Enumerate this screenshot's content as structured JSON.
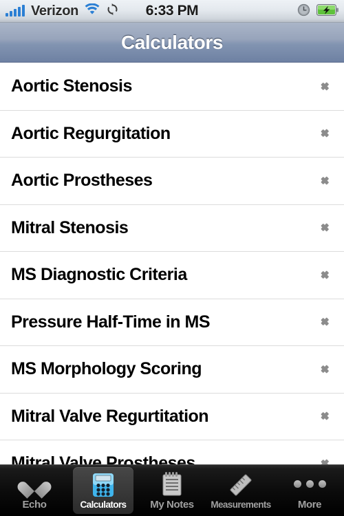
{
  "status_bar": {
    "signal_icon": "signal-bars-icon",
    "signal_bars": 5,
    "carrier": "Verizon",
    "wifi_icon": "wifi-icon",
    "sync_icon": "sync-rotate-icon",
    "time": "6:33 PM",
    "alarm_icon": "alarm-clock-icon",
    "battery_icon": "battery-charging-icon",
    "accent_blue": "#2b7fd4"
  },
  "navbar": {
    "title": "Calculators",
    "gradient_top": "#aab5c8",
    "gradient_bottom": "#6e81a3"
  },
  "list": {
    "chevron_icon": "chevron-right-icon",
    "rows": [
      {
        "label": "Aortic Stenosis"
      },
      {
        "label": "Aortic Regurgitation"
      },
      {
        "label": "Aortic Prostheses"
      },
      {
        "label": "Mitral Stenosis"
      },
      {
        "label": "MS Diagnostic Criteria"
      },
      {
        "label": "Pressure Half-Time in MS"
      },
      {
        "label": "MS Morphology Scoring"
      },
      {
        "label": "Mitral Valve Regurtitation"
      },
      {
        "label": "Mitral Valve Prostheses"
      }
    ]
  },
  "tabbar": {
    "selected_index": 1,
    "tabs": [
      {
        "label": "Echo",
        "icon": "heart-icon"
      },
      {
        "label": "Calculators",
        "icon": "calculator-icon"
      },
      {
        "label": "My Notes",
        "icon": "notepad-icon"
      },
      {
        "label": "Measurements",
        "icon": "ruler-icon"
      },
      {
        "label": "More",
        "icon": "ellipsis-icon"
      }
    ]
  }
}
